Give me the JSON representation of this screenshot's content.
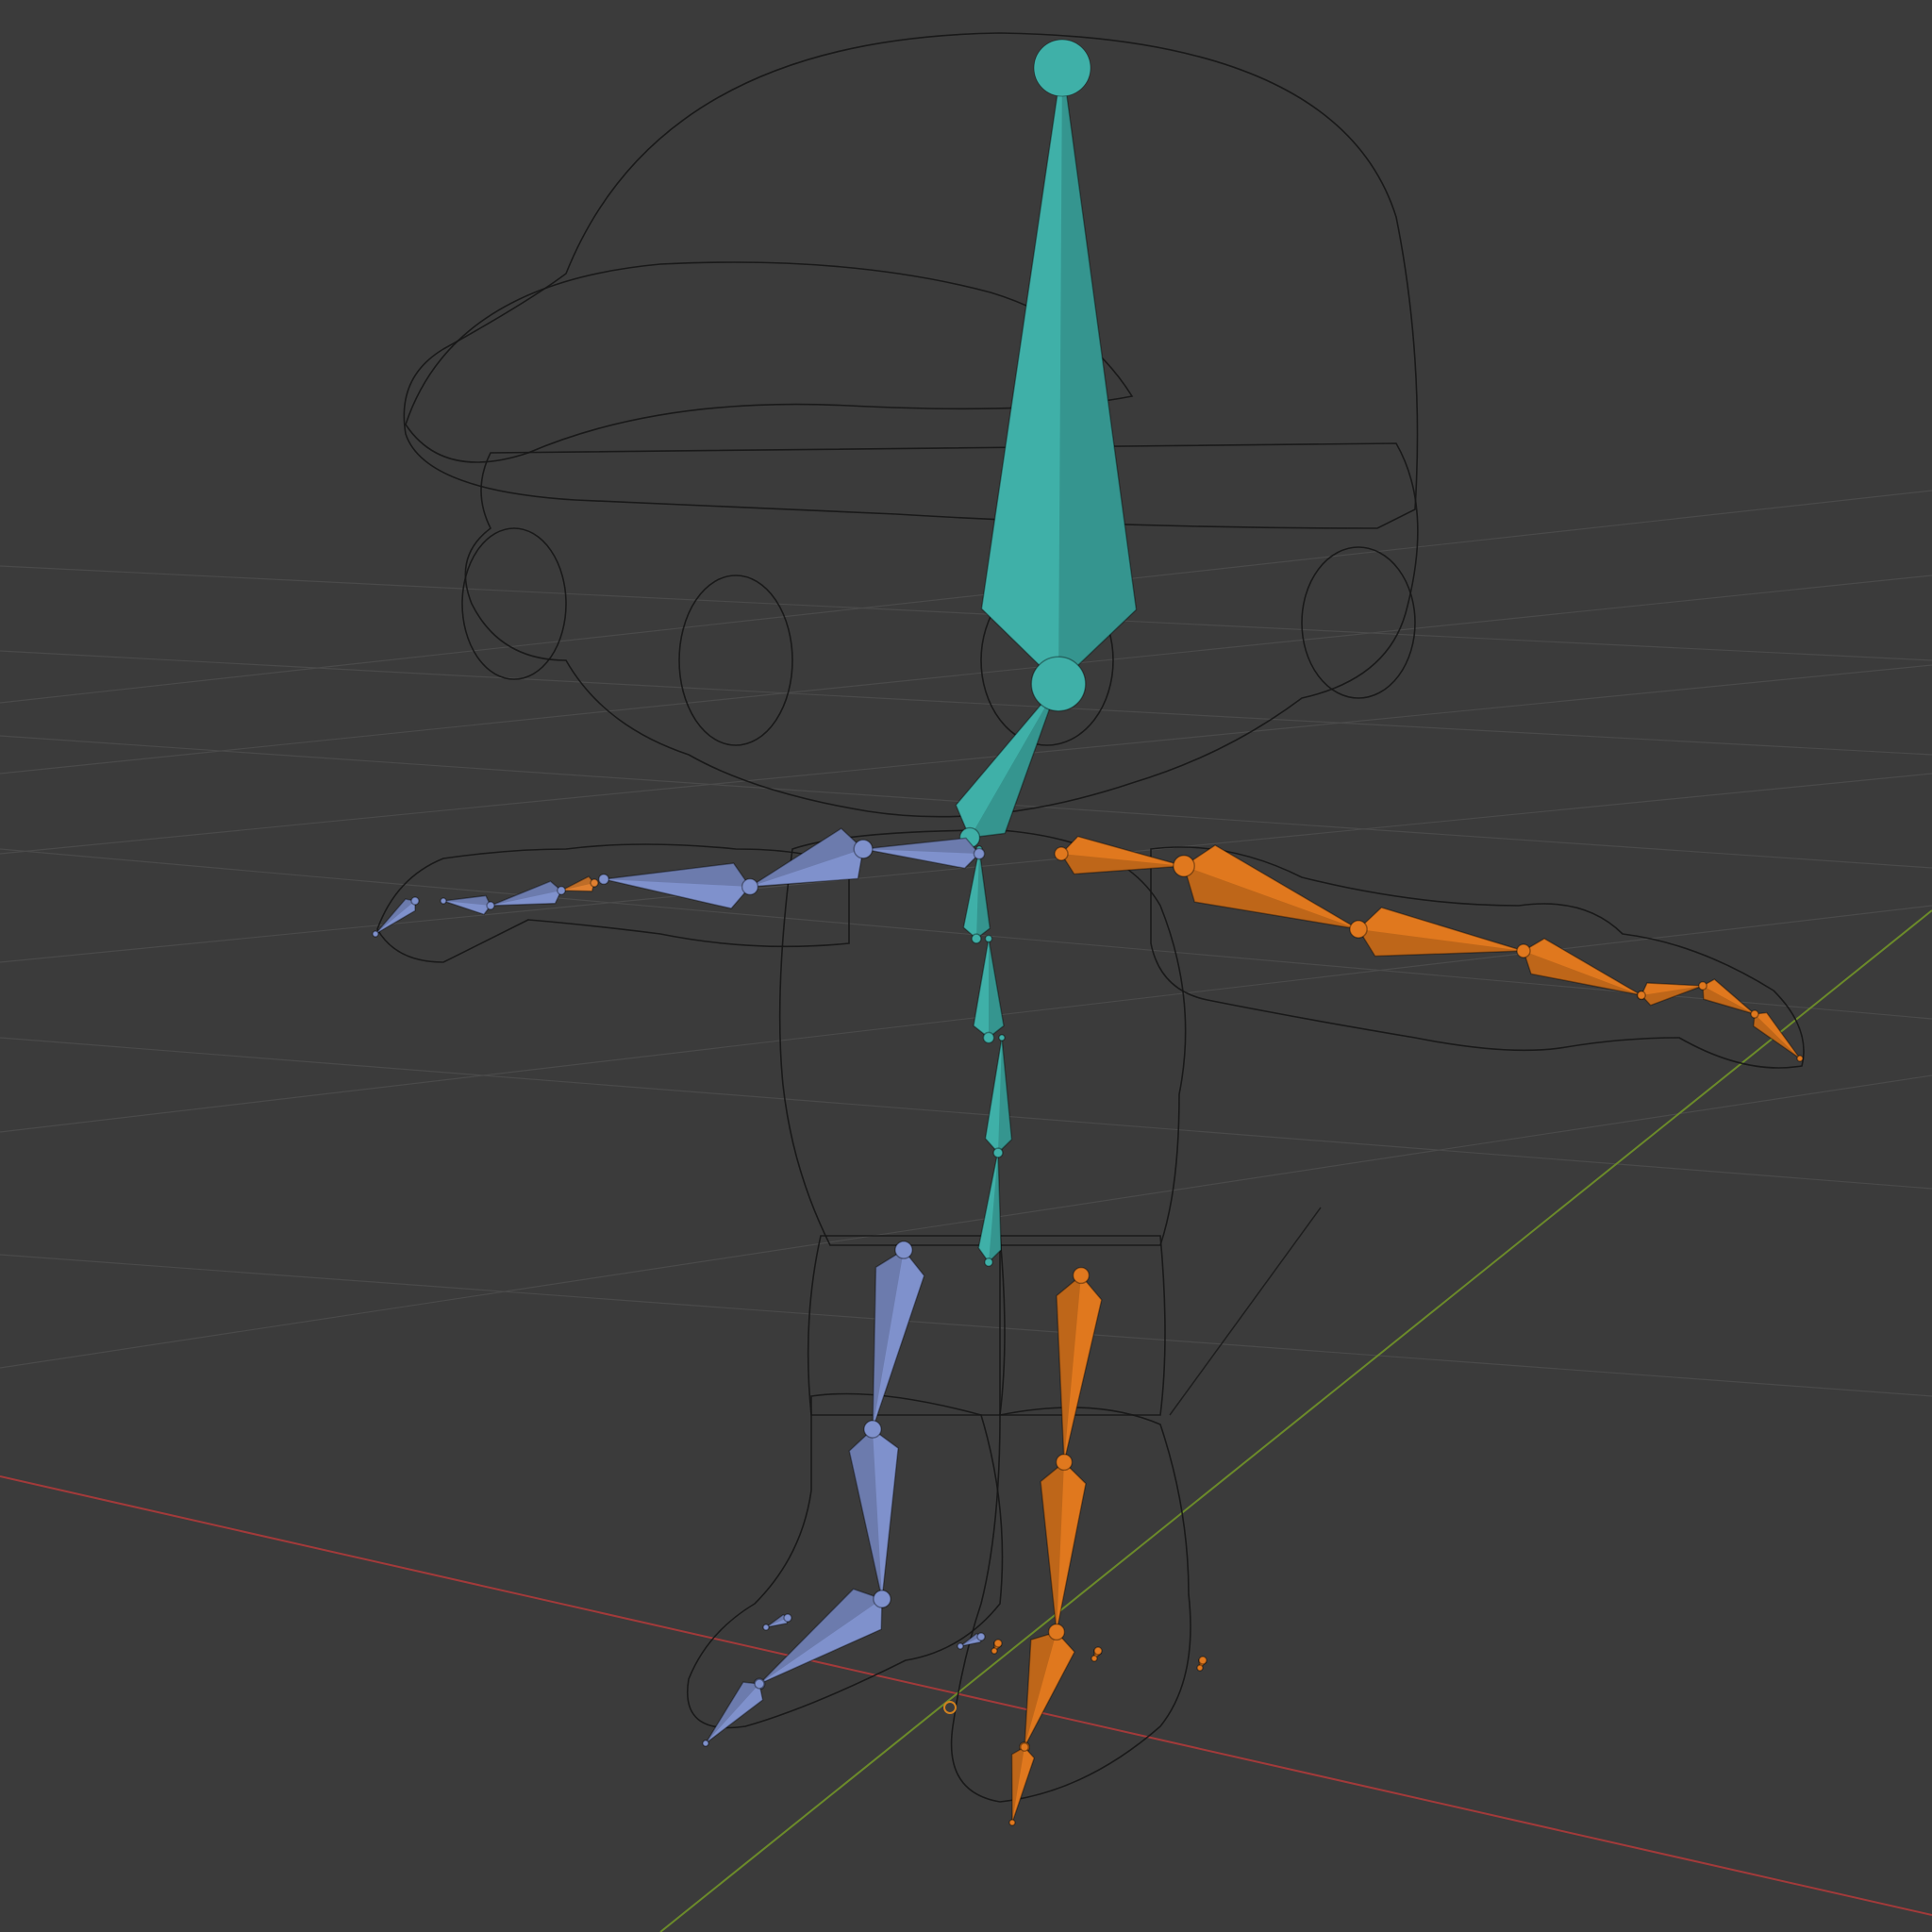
{
  "viewport": {
    "mode": "wireframe",
    "object": "character-mesh",
    "armature": "armature"
  },
  "colors": {
    "background": "#3b3b3b",
    "grid": "#4a4a4a",
    "axis_x": "#a23a3a",
    "axis_y": "#6b8a2a",
    "mesh_wire": "#161616",
    "bone_center": "#3fb0a8",
    "bone_left": "#7f91cc",
    "bone_right": "#e0781e",
    "selection": "#e08030"
  },
  "icons": {
    "cursor": "3d-cursor-icon"
  }
}
